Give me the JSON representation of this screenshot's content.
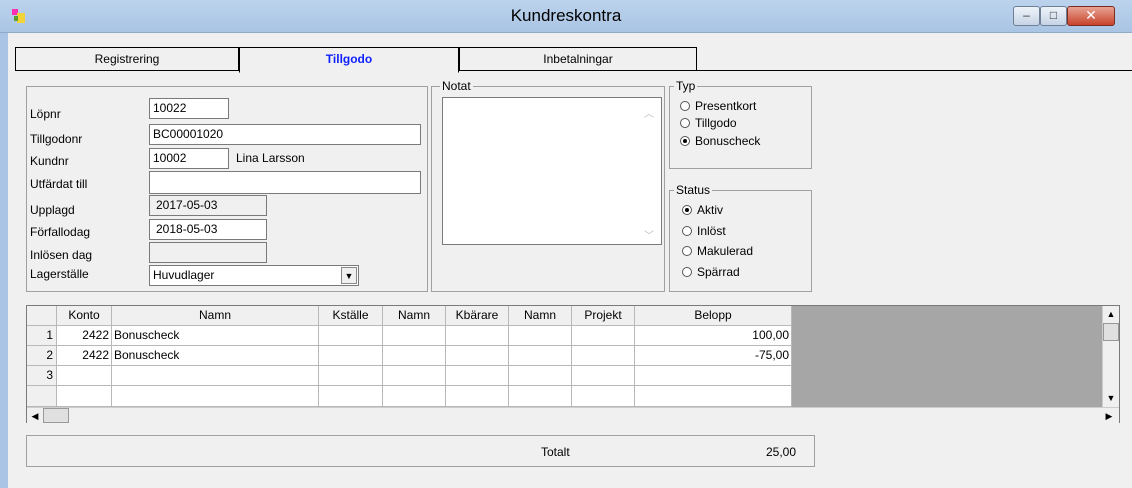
{
  "window": {
    "title": "Kundreskontra",
    "controls": {
      "minimize": "–",
      "maximize": "□",
      "close": "✕"
    }
  },
  "tabs": [
    {
      "label": "Registrering",
      "active": false
    },
    {
      "label": "Tillgodo",
      "active": true
    },
    {
      "label": "Inbetalningar",
      "active": false
    }
  ],
  "form": {
    "lopnr": {
      "label": "Löpnr",
      "value": "10022"
    },
    "tillgodonr": {
      "label": "Tillgodonr",
      "value": "BC00001020"
    },
    "kundnr": {
      "label": "Kundnr",
      "value": "10002",
      "name": "Lina Larsson"
    },
    "utfardat_till": {
      "label": "Utfärdat till",
      "value": ""
    },
    "upplagd": {
      "label": "Upplagd",
      "value": "2017-05-03"
    },
    "forfallodag": {
      "label": "Förfallodag",
      "value": "2018-05-03"
    },
    "inlosen_dag": {
      "label": "Inlösen dag",
      "value": ""
    },
    "lagerstalle": {
      "label": "Lagerställe",
      "value": "Huvudlager"
    }
  },
  "notat": {
    "label": "Notat",
    "value": ""
  },
  "typ": {
    "label": "Typ",
    "options": [
      {
        "label": "Presentkort",
        "selected": false
      },
      {
        "label": "Tillgodo",
        "selected": false
      },
      {
        "label": "Bonuscheck",
        "selected": true
      }
    ]
  },
  "status": {
    "label": "Status",
    "options": [
      {
        "label": "Aktiv",
        "selected": true
      },
      {
        "label": "Inlöst",
        "selected": false
      },
      {
        "label": "Makulerad",
        "selected": false
      },
      {
        "label": "Spärrad",
        "selected": false
      }
    ]
  },
  "grid": {
    "columns": [
      "Konto",
      "Namn",
      "Kställe",
      "Namn",
      "Kbärare",
      "Namn",
      "Projekt",
      "Belopp"
    ],
    "rows": [
      {
        "n": "1",
        "konto": "2422",
        "namn": "Bonuscheck",
        "belopp": "100,00"
      },
      {
        "n": "2",
        "konto": "2422",
        "namn": "Bonuscheck",
        "belopp": "-75,00"
      },
      {
        "n": "3",
        "konto": "",
        "namn": "",
        "belopp": ""
      }
    ]
  },
  "totals": {
    "label": "Totalt",
    "value": "25,00"
  },
  "colors": {
    "titlebar": "#a9c4e4",
    "active_tab_text": "#1020ff",
    "grid_gray": "#a6a6a6"
  }
}
